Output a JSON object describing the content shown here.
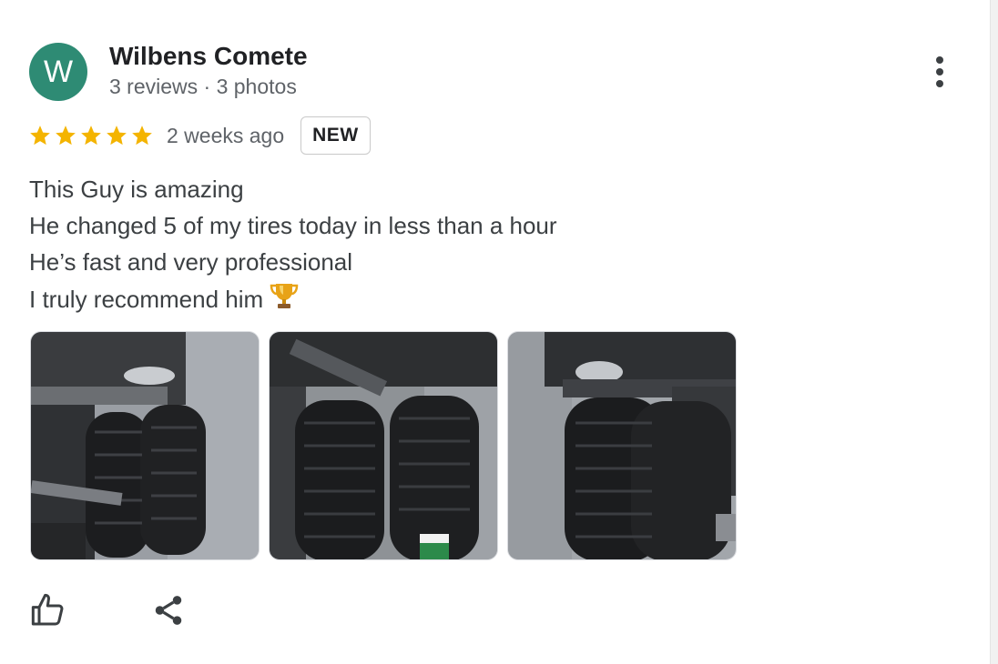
{
  "review": {
    "author": {
      "initial": "W",
      "name": "Wilbens Comete",
      "meta": "3 reviews · 3 photos",
      "avatar_color": "#2e8b74"
    },
    "rating": 5,
    "max_rating": 5,
    "star_color": "#f4b400",
    "time": "2 weeks ago",
    "badge": "NEW",
    "text_lines": [
      "This Guy is amazing",
      "He changed 5 of my tires today in less than a hour",
      "He’s fast and very professional",
      "I truly recommend him"
    ],
    "photos": [
      {
        "icon": "truck-rear-tires-photo-1"
      },
      {
        "icon": "new-tires-closeup-photo-2"
      },
      {
        "icon": "truck-rear-tires-photo-3"
      }
    ]
  },
  "actions": {
    "like_icon": "thumbs-up-icon",
    "share_icon": "share-icon",
    "more_icon": "more-vert-icon"
  }
}
